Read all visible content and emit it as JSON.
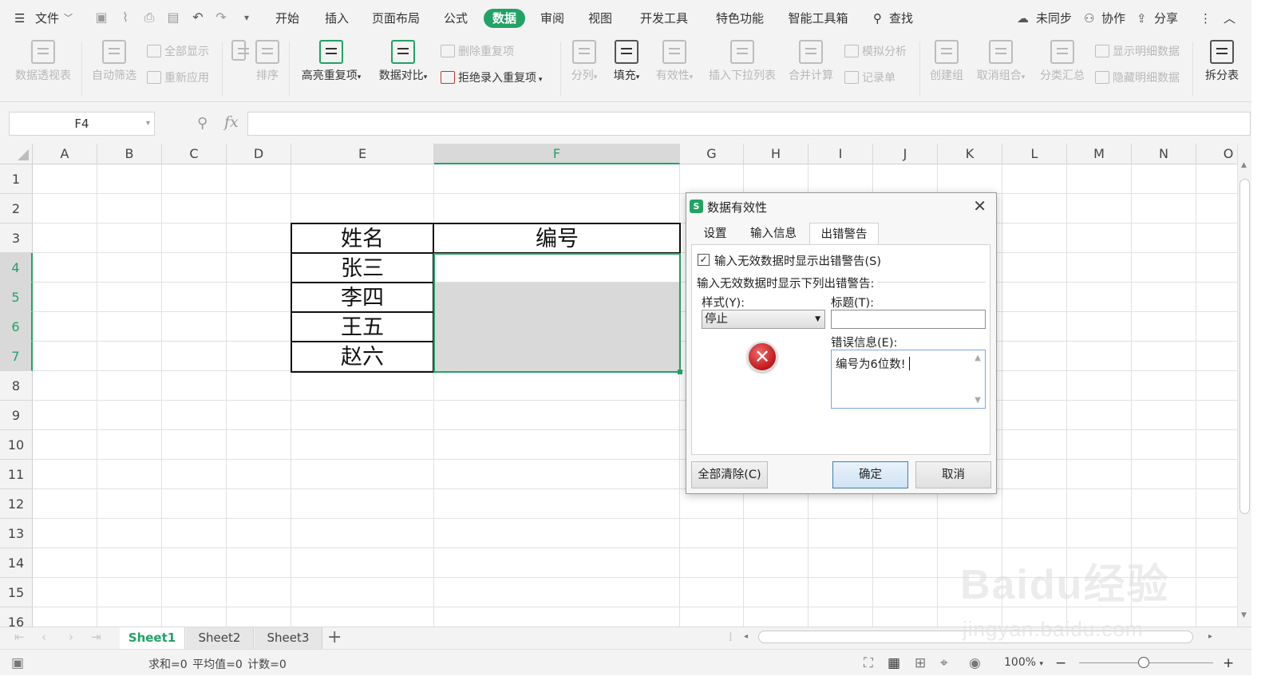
{
  "menubar": {
    "file": "文件",
    "tabs": [
      "开始",
      "插入",
      "页面布局",
      "公式",
      "数据",
      "审阅",
      "视图",
      "开发工具",
      "特色功能",
      "智能工具箱"
    ],
    "active_tab": "数据",
    "search": "查找",
    "sync": "未同步",
    "collab": "协作",
    "share": "分享"
  },
  "ribbon": {
    "pivot": "数据透视表",
    "autofilter": "自动筛选",
    "show_all": "全部显示",
    "reapply": "重新应用",
    "sort": "排序",
    "highlight_dup": "高亮重复项",
    "compare": "数据对比",
    "remove_dup": "删除重复项",
    "reject_dup": "拒绝录入重复项",
    "split_col": "分列",
    "fill": "填充",
    "validity": "有效性",
    "dropdown": "插入下拉列表",
    "consolidate": "合并计算",
    "what_if": "模拟分析",
    "record": "记录单",
    "group": "创建组",
    "ungroup": "取消组合",
    "subtotal": "分类汇总",
    "show_detail": "显示明细数据",
    "hide_detail": "隐藏明细数据",
    "split_table": "拆分表"
  },
  "formula_bar": {
    "name_box": "F4",
    "fx": "fx",
    "value": ""
  },
  "grid": {
    "columns": [
      "A",
      "B",
      "C",
      "D",
      "E",
      "F",
      "G",
      "H",
      "I",
      "J",
      "K",
      "L",
      "M",
      "N",
      "O"
    ],
    "rows": [
      "1",
      "2",
      "3",
      "4",
      "5",
      "6",
      "7",
      "8",
      "9",
      "10",
      "11",
      "12",
      "13",
      "14",
      "15",
      "16"
    ],
    "selected_cell": "F4",
    "table": {
      "header": [
        "姓名",
        "编号"
      ],
      "names": [
        "张三",
        "李四",
        "王五",
        "赵六"
      ]
    }
  },
  "sheets": {
    "tabs": [
      "Sheet1",
      "Sheet2",
      "Sheet3"
    ],
    "active": "Sheet1",
    "add": "+"
  },
  "statusbar": {
    "summary": "求和=0  平均值=0  计数=0",
    "zoom": "100%"
  },
  "dialog": {
    "title": "数据有效性",
    "tabs": [
      "设置",
      "输入信息",
      "出错警告"
    ],
    "active_tab": "出错警告",
    "checkbox_label": "输入无效数据时显示出错警告(S)",
    "checkbox_checked": true,
    "group_label": "输入无效数据时显示下列出错警告:",
    "style_label": "样式(Y):",
    "style_value": "停止",
    "title_label": "标题(T):",
    "title_value": "",
    "error_label": "错误信息(E):",
    "error_value": "编号为6位数!",
    "clear_all": "全部清除(C)",
    "ok": "确定",
    "cancel": "取消"
  },
  "watermark": {
    "logo": "Baidu经验",
    "url": "jingyan.baidu.com"
  },
  "colors": {
    "accent": "#21a366",
    "selection_fill": "#d9d9d9",
    "stop_icon": "#c0161b"
  }
}
